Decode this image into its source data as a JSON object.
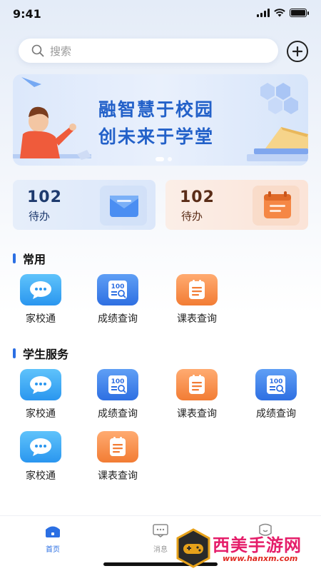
{
  "status_bar": {
    "time": "9:41"
  },
  "search": {
    "placeholder": "搜索"
  },
  "banner": {
    "line1": "融智慧于校园",
    "line2": "创未来于学堂"
  },
  "todo_cards": [
    {
      "count": "102",
      "label": "待办",
      "color": "#1e3a6e"
    },
    {
      "count": "102",
      "label": "待办",
      "color": "#5a2c17"
    }
  ],
  "sections": {
    "common": {
      "title": "常用",
      "items": [
        {
          "label": "家校通",
          "icon": "chat-bubble-icon"
        },
        {
          "label": "成绩查询",
          "icon": "score-report-icon"
        },
        {
          "label": "课表查询",
          "icon": "schedule-list-icon"
        }
      ]
    },
    "student": {
      "title": "学生服务",
      "items": [
        {
          "label": "家校通",
          "icon": "chat-bubble-icon"
        },
        {
          "label": "成绩查询",
          "icon": "score-report-icon"
        },
        {
          "label": "课表查询",
          "icon": "schedule-list-icon"
        },
        {
          "label": "成绩查询",
          "icon": "score-report-icon"
        },
        {
          "label": "家校通",
          "icon": "chat-bubble-icon"
        },
        {
          "label": "课表查询",
          "icon": "schedule-list-icon"
        }
      ]
    }
  },
  "tab_bar": {
    "home": "首页",
    "messages": "消息"
  },
  "watermark": {
    "text": "西美手游网",
    "url": "www.hanxm.com"
  },
  "colors": {
    "accent": "#2b6fe3",
    "banner_text": "#2361c9",
    "watermark": "#e51e6a"
  }
}
